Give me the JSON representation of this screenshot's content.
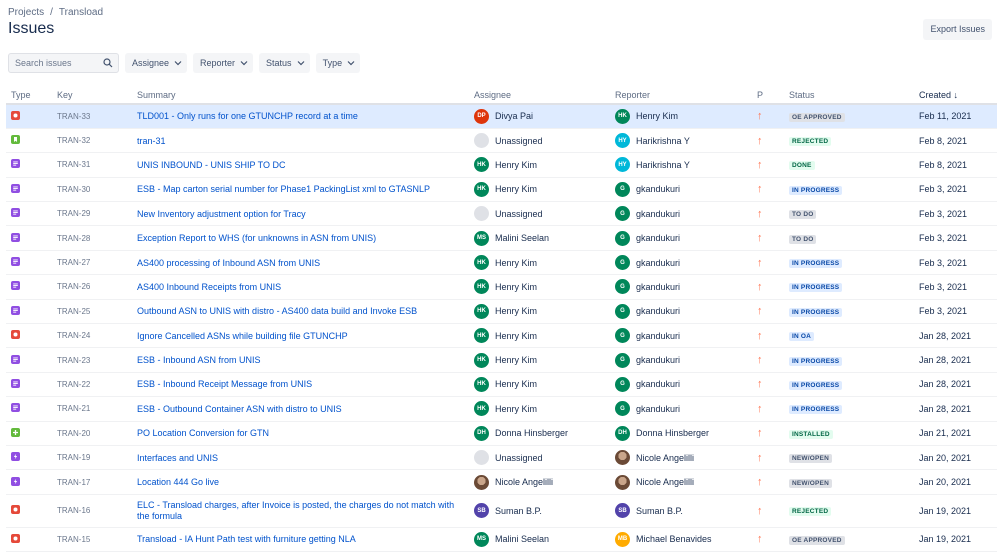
{
  "breadcrumb": {
    "project_root": "Projects",
    "separator": "/",
    "project": "Transload"
  },
  "page_title": "Issues",
  "export_label": "Export Issues",
  "search": {
    "placeholder": "Search issues"
  },
  "filters": {
    "assignee": "Assignee",
    "reporter": "Reporter",
    "status": "Status",
    "type": "Type"
  },
  "columns": {
    "type": "Type",
    "key": "Key",
    "summary": "Summary",
    "assignee": "Assignee",
    "reporter": "Reporter",
    "priority": "P",
    "status": "Status",
    "created": "Created",
    "sort_indicator": "↓"
  },
  "colors": {
    "accent": "#0052cc",
    "bug": "#e5493a",
    "story": "#63ba3c",
    "task": "#904ee2",
    "priority_high": "#ff7452",
    "selected_row": "#deebff"
  },
  "rows": [
    {
      "type": "bug",
      "key": "TRAN-33",
      "summary": "TLD001 - Only runs for one GTUNCHP record at a time",
      "assignee": {
        "name": "Divya Pai",
        "initials": "DP",
        "color": "#de350b"
      },
      "reporter": {
        "name": "Henry Kim",
        "initials": "HK",
        "color": "#00875a"
      },
      "priority_icon": "arrow-up-icon",
      "status": "OE APPROVED",
      "status_style": "default",
      "created": "Feb 11, 2021"
    },
    {
      "type": "story",
      "key": "TRAN-32",
      "summary": "tran-31",
      "assignee": {
        "name": "Unassigned",
        "initials": "",
        "color": "unassigned"
      },
      "reporter": {
        "name": "Harikrishna Y",
        "initials": "HY",
        "color": "#00b8d9"
      },
      "priority_icon": "arrow-up-icon",
      "status": "REJECTED",
      "status_style": "success",
      "created": "Feb 8, 2021"
    },
    {
      "type": "task",
      "key": "TRAN-31",
      "summary": "UNIS INBOUND - UNIS SHIP TO DC",
      "assignee": {
        "name": "Henry Kim",
        "initials": "HK",
        "color": "#00875a"
      },
      "reporter": {
        "name": "Harikrishna Y",
        "initials": "HY",
        "color": "#00b8d9"
      },
      "priority_icon": "arrow-up-icon",
      "status": "DONE",
      "status_style": "success",
      "created": "Feb 8, 2021"
    },
    {
      "type": "task",
      "key": "TRAN-30",
      "summary": "ESB - Map carton serial number for Phase1 PackingList xml to GTASNLP",
      "assignee": {
        "name": "Henry Kim",
        "initials": "HK",
        "color": "#00875a"
      },
      "reporter": {
        "name": "gkandukuri",
        "initials": "G",
        "color": "#00875a"
      },
      "priority_icon": "arrow-up-icon",
      "status": "IN PROGRESS",
      "status_style": "progress",
      "created": "Feb 3, 2021"
    },
    {
      "type": "task",
      "key": "TRAN-29",
      "summary": "New Inventory adjustment option for Tracy",
      "assignee": {
        "name": "Unassigned",
        "initials": "",
        "color": "unassigned"
      },
      "reporter": {
        "name": "gkandukuri",
        "initials": "G",
        "color": "#00875a"
      },
      "priority_icon": "arrow-up-icon",
      "status": "TO DO",
      "status_style": "default",
      "created": "Feb 3, 2021"
    },
    {
      "type": "task",
      "key": "TRAN-28",
      "summary": "Exception Report to WHS (for unknowns in ASN from UNIS)",
      "assignee": {
        "name": "Malini Seelan",
        "initials": "MS",
        "color": "#00875a"
      },
      "reporter": {
        "name": "gkandukuri",
        "initials": "G",
        "color": "#00875a"
      },
      "priority_icon": "arrow-up-icon",
      "status": "TO DO",
      "status_style": "default",
      "created": "Feb 3, 2021"
    },
    {
      "type": "task",
      "key": "TRAN-27",
      "summary": "AS400 processing of Inbound ASN from UNIS",
      "assignee": {
        "name": "Henry Kim",
        "initials": "HK",
        "color": "#00875a"
      },
      "reporter": {
        "name": "gkandukuri",
        "initials": "G",
        "color": "#00875a"
      },
      "priority_icon": "arrow-up-icon",
      "status": "IN PROGRESS",
      "status_style": "progress",
      "created": "Feb 3, 2021"
    },
    {
      "type": "task",
      "key": "TRAN-26",
      "summary": "AS400 Inbound Receipts from UNIS",
      "assignee": {
        "name": "Henry Kim",
        "initials": "HK",
        "color": "#00875a"
      },
      "reporter": {
        "name": "gkandukuri",
        "initials": "G",
        "color": "#00875a"
      },
      "priority_icon": "arrow-up-icon",
      "status": "IN PROGRESS",
      "status_style": "progress",
      "created": "Feb 3, 2021"
    },
    {
      "type": "task",
      "key": "TRAN-25",
      "summary": "Outbound ASN to UNIS with distro - AS400 data build and Invoke ESB",
      "assignee": {
        "name": "Henry Kim",
        "initials": "HK",
        "color": "#00875a"
      },
      "reporter": {
        "name": "gkandukuri",
        "initials": "G",
        "color": "#00875a"
      },
      "priority_icon": "arrow-up-icon",
      "status": "IN PROGRESS",
      "status_style": "progress",
      "created": "Feb 3, 2021"
    },
    {
      "type": "bug",
      "key": "TRAN-24",
      "summary": "Ignore Cancelled ASNs while building file GTUNCHP",
      "assignee": {
        "name": "Henry Kim",
        "initials": "HK",
        "color": "#00875a"
      },
      "reporter": {
        "name": "gkandukuri",
        "initials": "G",
        "color": "#00875a"
      },
      "priority_icon": "arrow-up-icon",
      "status": "IN OA",
      "status_style": "progress",
      "created": "Jan 28, 2021"
    },
    {
      "type": "task",
      "key": "TRAN-23",
      "summary": "ESB - Inbound ASN from UNIS",
      "assignee": {
        "name": "Henry Kim",
        "initials": "HK",
        "color": "#00875a"
      },
      "reporter": {
        "name": "gkandukuri",
        "initials": "G",
        "color": "#00875a"
      },
      "priority_icon": "arrow-up-icon",
      "status": "IN PROGRESS",
      "status_style": "progress",
      "created": "Jan 28, 2021"
    },
    {
      "type": "task",
      "key": "TRAN-22",
      "summary": "ESB - Inbound Receipt Message from UNIS",
      "assignee": {
        "name": "Henry Kim",
        "initials": "HK",
        "color": "#00875a"
      },
      "reporter": {
        "name": "gkandukuri",
        "initials": "G",
        "color": "#00875a"
      },
      "priority_icon": "arrow-up-icon",
      "status": "IN PROGRESS",
      "status_style": "progress",
      "created": "Jan 28, 2021"
    },
    {
      "type": "task",
      "key": "TRAN-21",
      "summary": "ESB - Outbound Container ASN with distro to UNIS",
      "assignee": {
        "name": "Henry Kim",
        "initials": "HK",
        "color": "#00875a"
      },
      "reporter": {
        "name": "gkandukuri",
        "initials": "G",
        "color": "#00875a"
      },
      "priority_icon": "arrow-up-icon",
      "status": "IN PROGRESS",
      "status_style": "progress",
      "created": "Jan 28, 2021"
    },
    {
      "type": "improvement",
      "key": "TRAN-20",
      "summary": "PO Location Conversion for GTN",
      "assignee": {
        "name": "Donna Hinsberger",
        "initials": "DH",
        "color": "#00875a"
      },
      "reporter": {
        "name": "Donna Hinsberger",
        "initials": "DH",
        "color": "#00875a"
      },
      "priority_icon": "arrow-up-icon",
      "status": "INSTALLED",
      "status_style": "success",
      "created": "Jan 21, 2021"
    },
    {
      "type": "epic",
      "key": "TRAN-19",
      "summary": "Interfaces and UNIS",
      "assignee": {
        "name": "Unassigned",
        "initials": "",
        "color": "unassigned"
      },
      "reporter": {
        "name": "Nicole Angelilli",
        "initials": "",
        "color": "photo"
      },
      "priority_icon": "arrow-up-icon",
      "status": "NEW/OPEN",
      "status_style": "default",
      "created": "Jan 20, 2021"
    },
    {
      "type": "epic",
      "key": "TRAN-17",
      "summary": "Location 444 Go live",
      "assignee": {
        "name": "Nicole Angelilli",
        "initials": "",
        "color": "photo"
      },
      "reporter": {
        "name": "Nicole Angelilli",
        "initials": "",
        "color": "photo"
      },
      "priority_icon": "arrow-up-icon",
      "status": "NEW/OPEN",
      "status_style": "default",
      "created": "Jan 20, 2021"
    },
    {
      "type": "bug",
      "key": "TRAN-16",
      "summary": "ELC - Transload charges, after Invoice is posted, the charges do not match with the formula",
      "assignee": {
        "name": "Suman B.P.",
        "initials": "SB",
        "color": "#5243aa"
      },
      "reporter": {
        "name": "Suman B.P.",
        "initials": "SB",
        "color": "#5243aa"
      },
      "priority_icon": "arrow-up-icon",
      "status": "REJECTED",
      "status_style": "success",
      "created": "Jan 19, 2021"
    },
    {
      "type": "bug",
      "key": "TRAN-15",
      "summary": "Transload - IA Hunt Path test with furniture getting NLA",
      "assignee": {
        "name": "Malini Seelan",
        "initials": "MS",
        "color": "#00875a"
      },
      "reporter": {
        "name": "Michael Benavides",
        "initials": "MB",
        "color": "#ffab00"
      },
      "priority_icon": "arrow-up-icon",
      "status": "OE APPROVED",
      "status_style": "default",
      "created": "Jan 19, 2021"
    }
  ]
}
